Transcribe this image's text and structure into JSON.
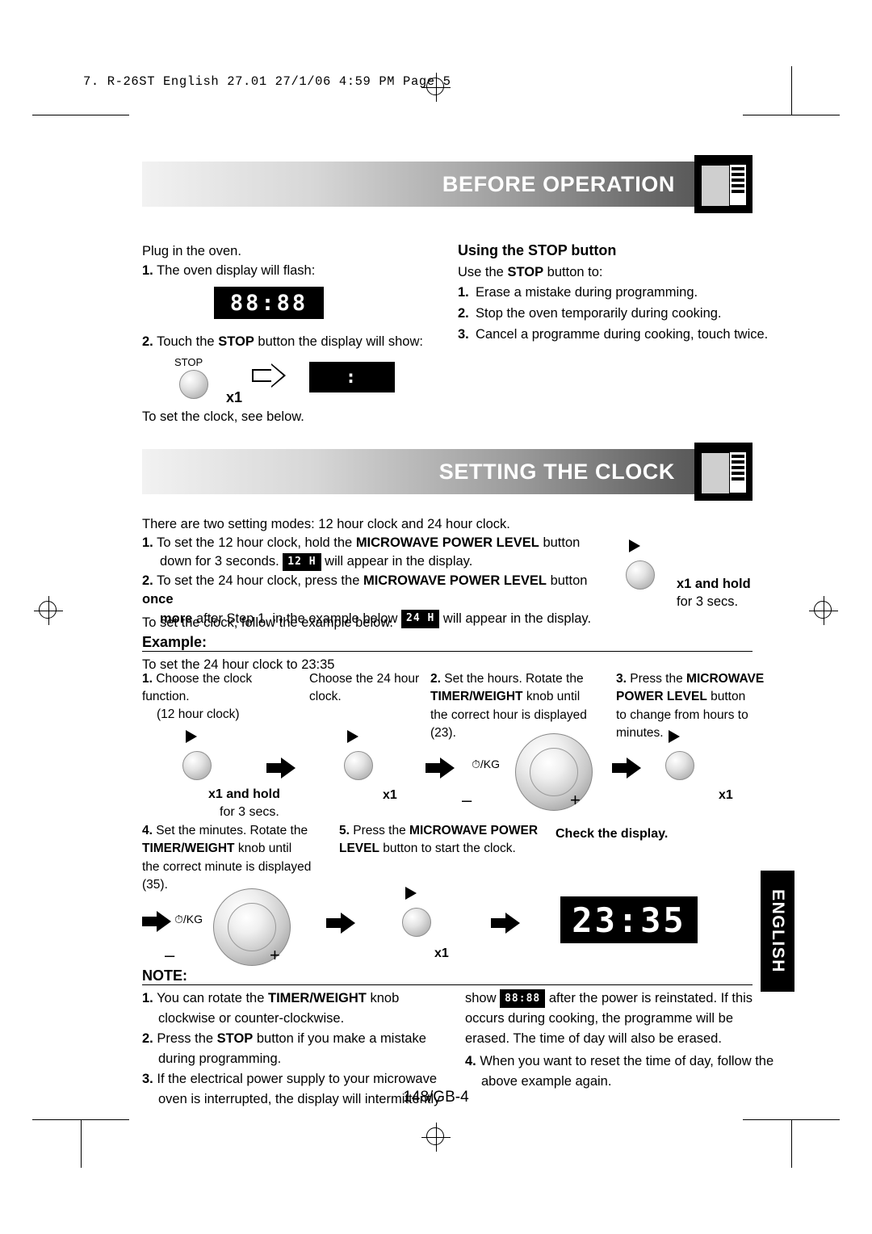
{
  "slug": "7. R-26ST English 27.01  27/1/06  4:59 PM  Page 5",
  "sections": {
    "before_operation": {
      "title": "BEFORE OPERATION",
      "left": {
        "line1": "Plug in the oven.",
        "step1_num": "1.",
        "step1": "The oven display will flash:",
        "display1": "88:88",
        "step2_num": "2.",
        "step2_a": "Touch the ",
        "step2_b": "STOP",
        "step2_c": " button the display will show:",
        "stop_label": "STOP",
        "press_count": "x1",
        "display2": ":",
        "footer": "To set the clock, see below."
      },
      "right": {
        "heading_a": "Using the ",
        "heading_b": "STOP",
        "heading_c": " button",
        "intro_a": "Use the ",
        "intro_b": "STOP",
        "intro_c": " button to:",
        "items": [
          {
            "n": "1.",
            "text": "Erase a mistake during programming."
          },
          {
            "n": "2.",
            "text": "Stop the oven temporarily during cooking."
          },
          {
            "n": "3.",
            "text": "Cancel a programme during cooking, touch twice."
          }
        ]
      }
    },
    "setting_the_clock": {
      "title": "SETTING THE CLOCK",
      "intro": "There are two setting modes: 12 hour clock and 24 hour clock.",
      "step1": {
        "n": "1.",
        "a": "To set the 12 hour clock, hold the ",
        "b": "MICROWAVE POWER LEVEL",
        "c": " button",
        "d": "down for 3 seconds. ",
        "tag": "12 H",
        "e": " will appear in the display."
      },
      "step2": {
        "n": "2.",
        "a": "To set the 24 hour clock, press the ",
        "b": "MICROWAVE POWER LEVEL",
        "c": " button ",
        "d": "once",
        "e": "more",
        "f": " after Step 1, in the example below ",
        "tag": "24 H",
        "g": " will appear in the display."
      },
      "follow": "To set the clock, follow the example below.",
      "hold_note_1": "x1 and hold",
      "hold_note_2": "for 3 secs.",
      "example_label": "Example:",
      "example_line": "To set the 24 hour clock to 23:35",
      "steps": [
        {
          "n": "1.",
          "text": "Choose the clock function.",
          "sub": "(12 hour clock)",
          "text2": "Choose the 24 hour",
          "sub2": "clock.",
          "press1": "x1 and hold",
          "press1b": "for 3 secs.",
          "press2": "x1"
        },
        {
          "n": "2.",
          "l1": "Set the hours. Rotate the",
          "l2_b": "TIMER/WEIGHT",
          "l2_r": " knob until",
          "l3": "the correct hour is displayed",
          "l4": "(23).",
          "knob_label": "/KG",
          "minus": "–",
          "plus": "+"
        },
        {
          "n": "3.",
          "l1_a": "Press the ",
          "l1_b": "MICROWAVE",
          "l2_b": "POWER LEVEL",
          "l2_r": " button",
          "l3": "to change from hours to",
          "l4": "minutes.",
          "press": "x1"
        },
        {
          "n": "4.",
          "l1": "Set the minutes. Rotate the",
          "l2_b": "TIMER/WEIGHT",
          "l2_r": " knob until",
          "l3": "the correct minute is displayed",
          "l4": "(35).",
          "knob_label": "/KG",
          "minus": "–",
          "plus": "+"
        },
        {
          "n": "5.",
          "l1_a": "Press the ",
          "l1_b": "MICROWAVE POWER",
          "l2_b": "LEVEL",
          "l2_r": " button to start the clock.",
          "press": "x1"
        },
        {
          "n": "",
          "check": "Check the display.",
          "display": "23:35"
        }
      ]
    },
    "note": {
      "title": "NOTE:",
      "items": [
        {
          "n": "1.",
          "l1_a": "You can rotate the ",
          "l1_b": "TIMER/WEIGHT",
          "l1_c": " knob",
          "l2": "clockwise or counter-clockwise."
        },
        {
          "n": "2.",
          "l1_a": "Press the ",
          "l1_b": "STOP",
          "l1_c": " button if you make a mistake",
          "l2": "during programming."
        },
        {
          "n": "3.",
          "l1": "If the electrical power supply to your microwave",
          "l2": "oven is interrupted, the display will intermittently"
        },
        {
          "n": "",
          "show_a": "show ",
          "tag": "88:88",
          "show_b": " after the power is reinstated. If this",
          "l2": "occurs during cooking, the programme will be",
          "l3": "erased. The time of day will also be erased."
        },
        {
          "n": "4.",
          "l1": "When you want to reset the time of day, follow the",
          "l2": "above example again."
        }
      ]
    }
  },
  "side_tab": "ENGLISH",
  "page_number": "148/GB-4"
}
